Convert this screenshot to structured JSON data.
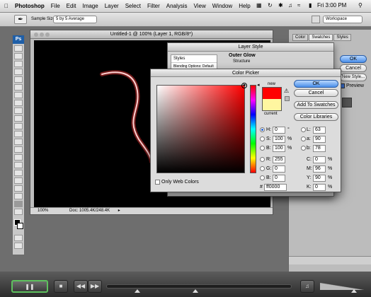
{
  "menubar": {
    "app": "Photoshop",
    "items": [
      "File",
      "Edit",
      "Image",
      "Layer",
      "Select",
      "Filter",
      "Analysis",
      "View",
      "Window",
      "Help"
    ],
    "clock": "Fri 3:00 PM"
  },
  "options": {
    "sample_size_label": "Sample Size:",
    "sample_size_value": "5 by 5 Average",
    "workspace_label": "Workspace"
  },
  "document": {
    "title": "Untitled-1 @ 100% (Layer 1, RGB/8*)",
    "zoom": "100%",
    "doc_size": "Doc: 1005.4K/248.4K"
  },
  "right_panel": {
    "tabs": [
      "Color",
      "Swatches",
      "Styles"
    ]
  },
  "layer_style": {
    "title": "Layer Style",
    "sidebar": [
      "Styles",
      "Blending Options: Default"
    ],
    "section_title": "Outer Glow",
    "section_sub": "Structure",
    "buttons": {
      "ok": "OK",
      "cancel": "Cancel",
      "new_style": "New Style...",
      "preview": "Preview"
    }
  },
  "color_picker": {
    "title": "Color Picker",
    "new_label": "new",
    "current_label": "current",
    "new_color": "#ff0000",
    "current_color": "#fff6a0",
    "buttons": {
      "ok": "OK",
      "cancel": "Cancel",
      "add_swatches": "Add To Swatches",
      "libraries": "Color Libraries"
    },
    "only_web_colors": "Only Web Colors",
    "hsb": [
      {
        "label": "H:",
        "value": "0",
        "unit": "°",
        "selected": true
      },
      {
        "label": "S:",
        "value": "100",
        "unit": "%",
        "selected": false
      },
      {
        "label": "B:",
        "value": "100",
        "unit": "%",
        "selected": false
      }
    ],
    "rgb": [
      {
        "label": "R:",
        "value": "255",
        "selected": false
      },
      {
        "label": "G:",
        "value": "0",
        "selected": false
      },
      {
        "label": "B:",
        "value": "0",
        "selected": false
      }
    ],
    "lab": [
      {
        "label": "L:",
        "value": "63"
      },
      {
        "label": "a:",
        "value": "90"
      },
      {
        "label": "b:",
        "value": "78"
      }
    ],
    "cmyk": [
      {
        "label": "C:",
        "value": "0",
        "unit": "%"
      },
      {
        "label": "M:",
        "value": "96",
        "unit": "%"
      },
      {
        "label": "Y:",
        "value": "90",
        "unit": "%"
      },
      {
        "label": "K:",
        "value": "0",
        "unit": "%"
      }
    ],
    "hex_label": "#",
    "hex": "ff0000"
  }
}
